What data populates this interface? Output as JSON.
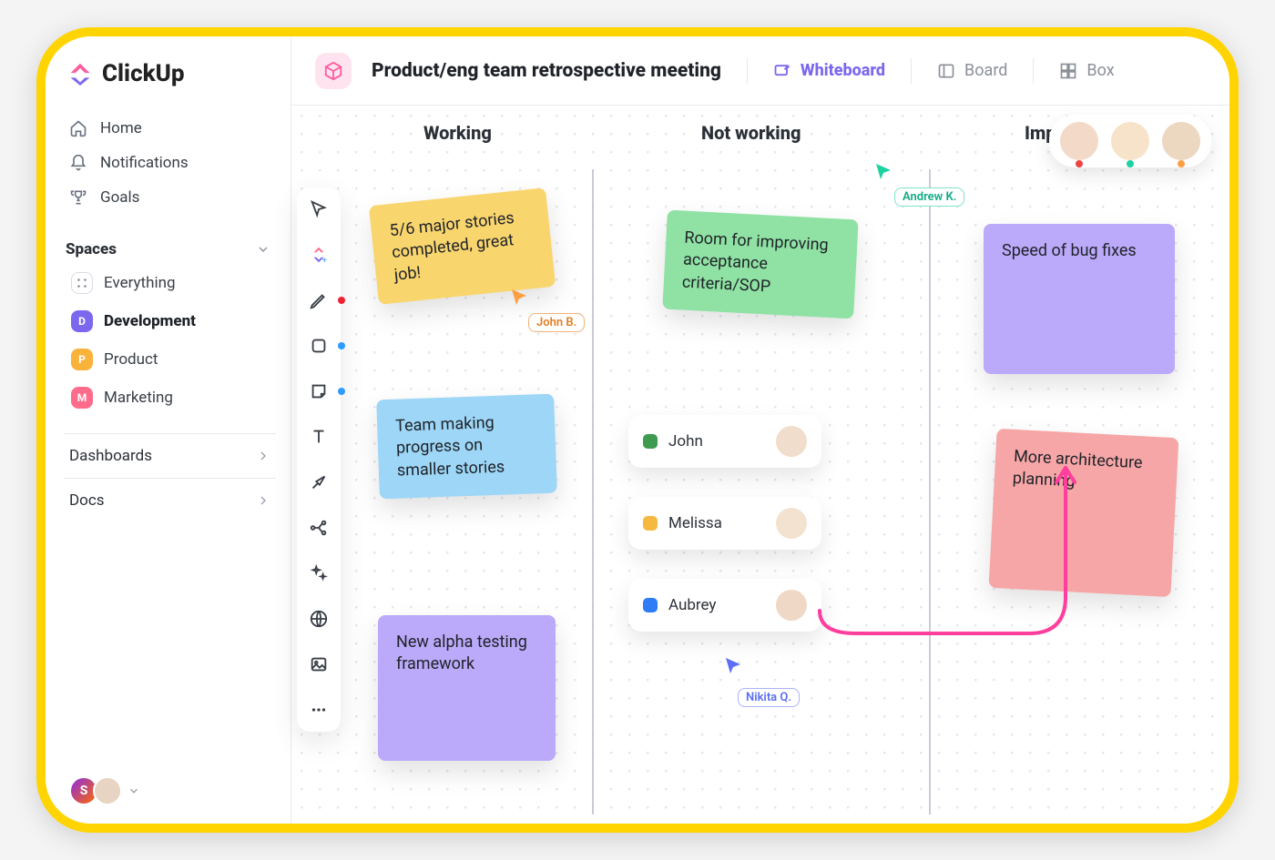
{
  "brand": "ClickUp",
  "nav": {
    "home": "Home",
    "notifications": "Notifications",
    "goals": "Goals"
  },
  "spaces": {
    "heading": "Spaces",
    "everything": "Everything",
    "items": [
      {
        "initial": "D",
        "label": "Development"
      },
      {
        "initial": "P",
        "label": "Product"
      },
      {
        "initial": "M",
        "label": "Marketing"
      }
    ]
  },
  "sidebar_sections": {
    "dashboards": "Dashboards",
    "docs": "Docs"
  },
  "header": {
    "title": "Product/eng team retrospective meeting",
    "tabs": {
      "whiteboard": "Whiteboard",
      "board": "Board",
      "box": "Box"
    }
  },
  "canvas": {
    "columns": {
      "working": "Working",
      "not_working": "Not working",
      "improve": "Improve"
    },
    "notes": {
      "n1": "5/6 major stories completed, great job!",
      "n2": "Team making progress on smaller stories",
      "n3": "New alpha testing framework",
      "n4": "Room for improving acceptance criteria/SOP",
      "n5": "Speed of bug fixes",
      "n6": "More architecture planning"
    },
    "cursors": {
      "john": "John B.",
      "andrew": "Andrew K.",
      "nikita": "Nikita Q."
    },
    "tasks": [
      {
        "name": "John",
        "color": "#3e9b4f"
      },
      {
        "name": "Melissa",
        "color": "#f5b942"
      },
      {
        "name": "Aubrey",
        "color": "#2e7cf6"
      }
    ],
    "presence_count": 3
  }
}
